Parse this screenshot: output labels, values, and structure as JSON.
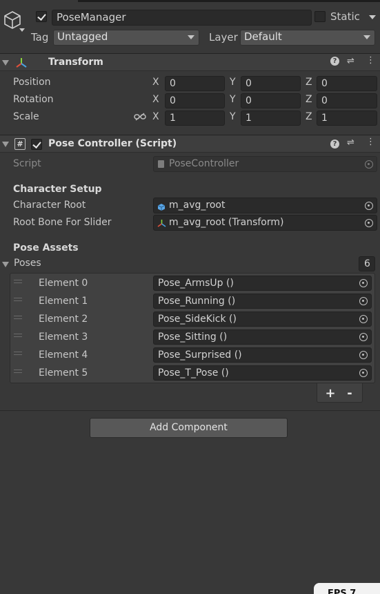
{
  "gameobject": {
    "name": "PoseManager",
    "active": true,
    "static_label": "Static",
    "tag_label": "Tag",
    "tag_value": "Untagged",
    "layer_label": "Layer",
    "layer_value": "Default"
  },
  "transform": {
    "title": "Transform",
    "rows": [
      {
        "label": "Position",
        "x": "0",
        "y": "0",
        "z": "0"
      },
      {
        "label": "Rotation",
        "x": "0",
        "y": "0",
        "z": "0"
      },
      {
        "label": "Scale",
        "x": "1",
        "y": "1",
        "z": "1"
      }
    ],
    "axis_x": "X",
    "axis_y": "Y",
    "axis_z": "Z"
  },
  "pose_controller": {
    "title": "Pose Controller (Script)",
    "enabled": true,
    "script_label": "Script",
    "script_value": "PoseController",
    "character_setup_title": "Character Setup",
    "character_root_label": "Character Root",
    "character_root_value": "m_avg_root",
    "root_bone_label": "Root Bone For Slider",
    "root_bone_value": "m_avg_root (Transform)",
    "pose_assets_title": "Pose Assets",
    "poses_label": "Poses",
    "poses_count": "6",
    "elements": [
      {
        "label": "Element 0",
        "value": "Pose_ArmsUp ()"
      },
      {
        "label": "Element 1",
        "value": "Pose_Running ()"
      },
      {
        "label": "Element 2",
        "value": "Pose_SideKick ()"
      },
      {
        "label": "Element 3",
        "value": "Pose_Sitting ()"
      },
      {
        "label": "Element 4",
        "value": "Pose_Surprised ()"
      },
      {
        "label": "Element 5",
        "value": "Pose_T_Pose ()"
      }
    ],
    "add_label": "+",
    "remove_label": "-"
  },
  "add_component_label": "Add Component",
  "corner_badge": "FPS 7",
  "colors": {
    "background": "#383838",
    "header": "#3e3e3e",
    "field": "#2a2a2a",
    "transform_icon_red": "#e0503a",
    "transform_icon_green": "#8ad33d",
    "transform_icon_blue": "#4aa3e0"
  }
}
